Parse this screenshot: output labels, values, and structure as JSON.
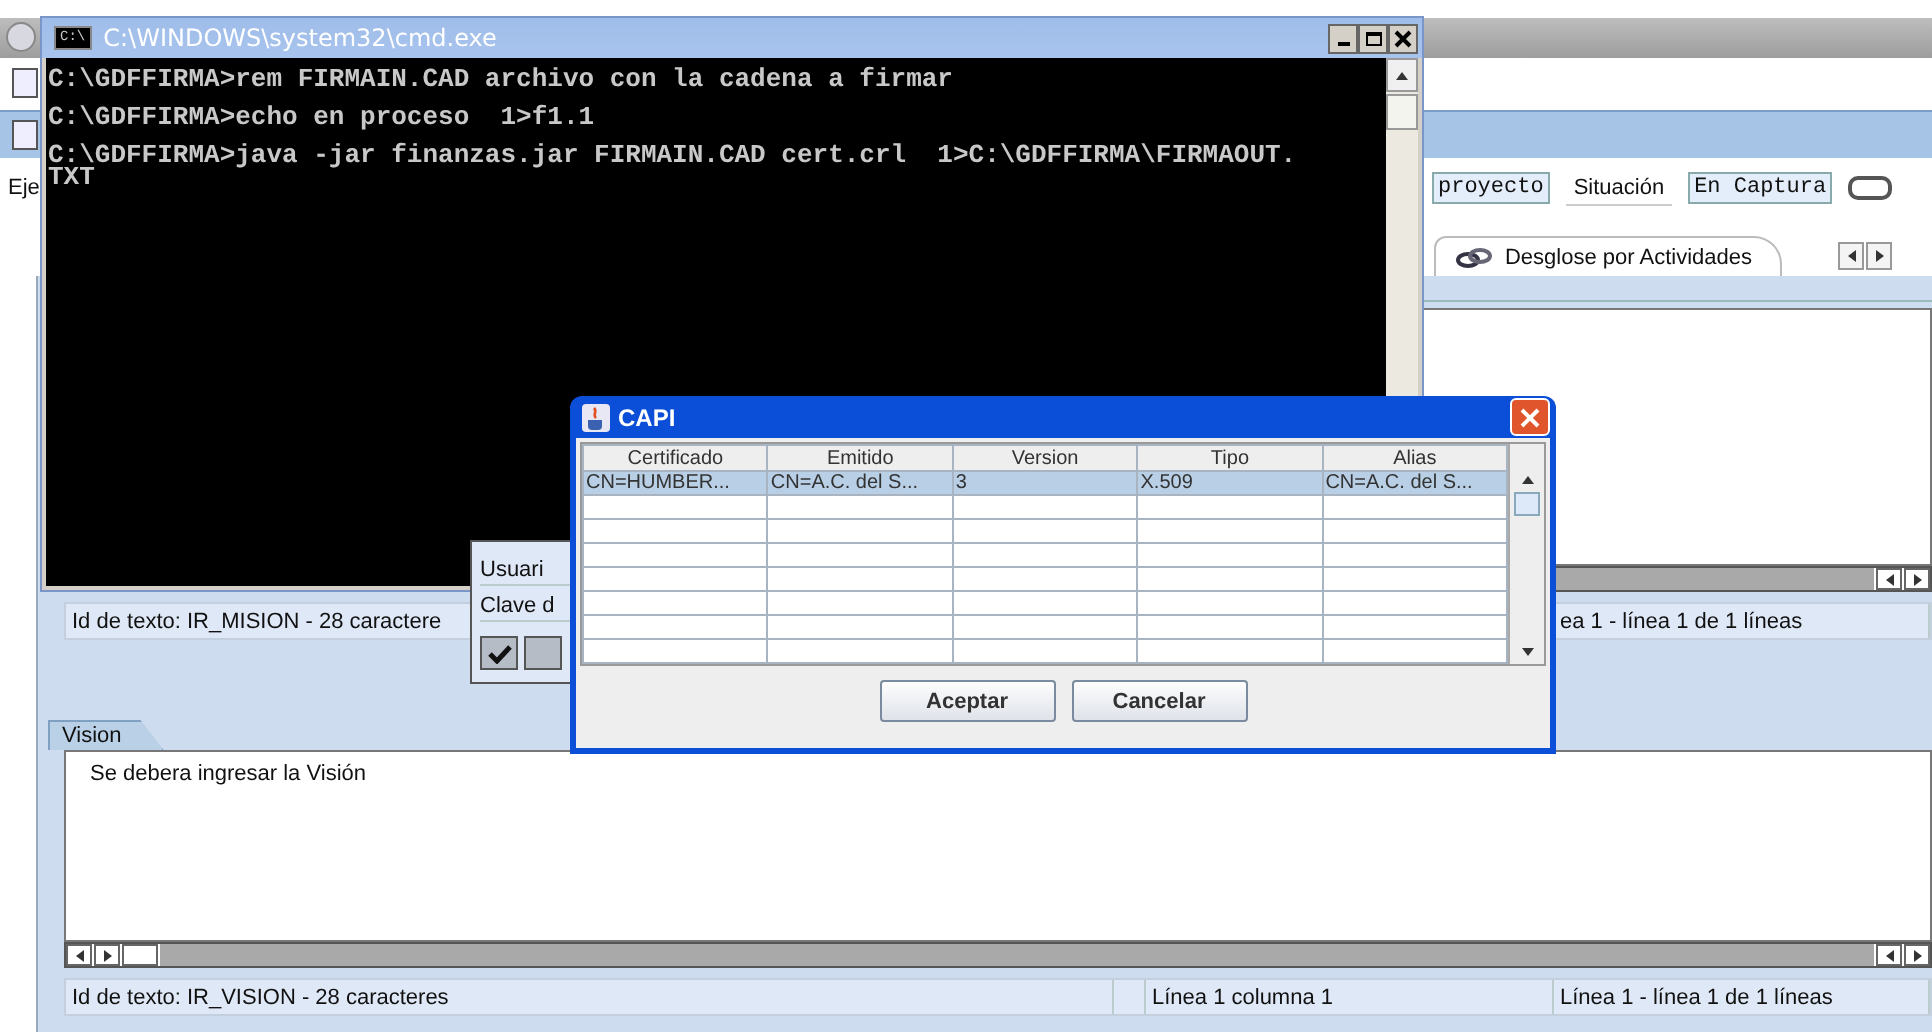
{
  "background_window": {
    "header": {
      "cut_label": "Eje",
      "fields": [
        {
          "kind": "value",
          "text": "proyecto"
        },
        {
          "kind": "label",
          "text": "Situación"
        },
        {
          "kind": "value",
          "text": "En Captura"
        }
      ]
    },
    "tabs": [
      {
        "label": "Desglose por Actividades",
        "selected": true
      }
    ],
    "mision": {
      "status": [
        "Id de texto: IR_MISION - 28 caractere",
        "ea 1 - línea 1 de 1 líneas"
      ]
    },
    "vision": {
      "tab": "Vision",
      "text": "Se debera ingresar la Visión",
      "status": [
        "Id de texto: IR_VISION - 28 caracteres",
        "Línea 1 columna 1",
        "Línea 1 - línea 1 de 1 líneas"
      ]
    }
  },
  "console_window": {
    "title": "C:\\WINDOWS\\system32\\cmd.exe",
    "icon_text": "C:\\",
    "lines": [
      {
        "kind": "line",
        "text": "C:\\GDFFIRMA>rem FIRMAIN.CAD archivo con la cadena a firmar"
      },
      {
        "kind": "line",
        "text": "C:\\GDFFIRMA>echo en proceso  1>f1.1"
      },
      {
        "kind": "line",
        "text": "C:\\GDFFIRMA>java -jar finanzas.jar FIRMAIN.CAD cert.crl  1>C:\\GDFFIRMA\\FIRMAOUT."
      },
      {
        "kind": "continuation",
        "text": "TXT"
      }
    ]
  },
  "login_popup": {
    "labels": [
      "Usuari",
      "Clave d"
    ]
  },
  "capi_dialog": {
    "title": "CAPI",
    "columns": [
      "Certificado",
      "Emitido",
      "Version",
      "Tipo",
      "Alias"
    ],
    "rows": [
      {
        "selected": true,
        "cells": [
          "CN=HUMBER...",
          "CN=A.C. del S...",
          "3",
          "X.509",
          "CN=A.C. del S..."
        ]
      }
    ],
    "buttons": [
      "Aceptar",
      "Cancelar"
    ]
  }
}
